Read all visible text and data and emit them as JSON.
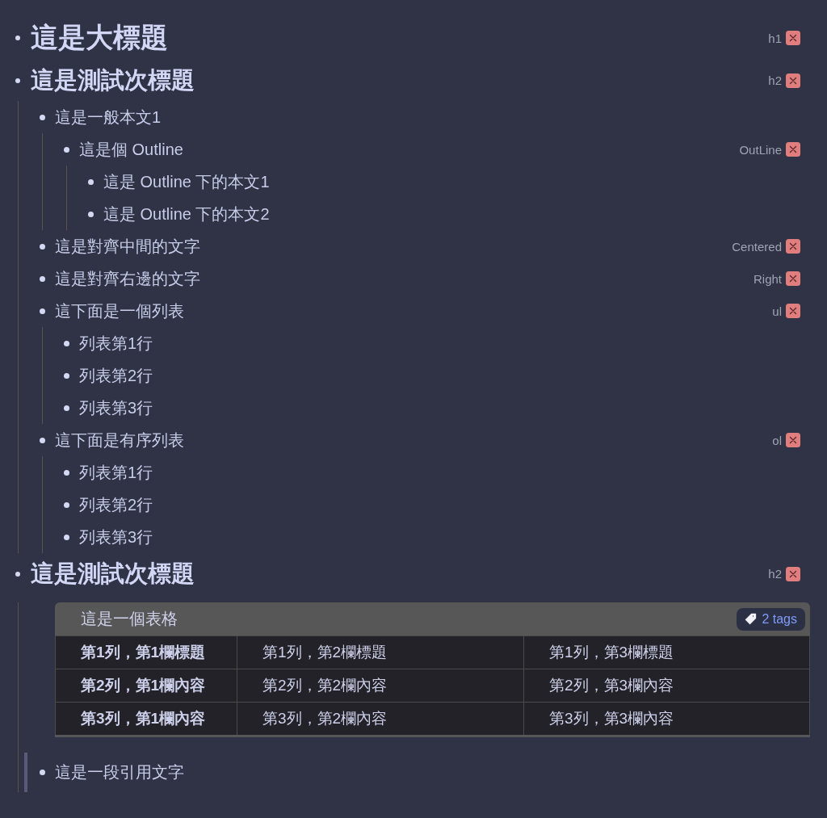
{
  "outline": [
    {
      "kind": "h1",
      "text": "這是大標題",
      "tag": "h1"
    },
    {
      "kind": "h2",
      "text": "這是測試次標題",
      "tag": "h2",
      "children": [
        {
          "kind": "text",
          "text": "這是一般本文1",
          "children": [
            {
              "kind": "text",
              "text": "這是個 Outline",
              "tag": "OutLine",
              "children": [
                {
                  "kind": "text",
                  "text": "這是 Outline 下的本文1"
                },
                {
                  "kind": "text",
                  "text": "這是 Outline 下的本文2"
                }
              ]
            }
          ]
        },
        {
          "kind": "text",
          "text": "這是對齊中間的文字",
          "tag": "Centered"
        },
        {
          "kind": "text",
          "text": "這是對齊右邊的文字",
          "tag": "Right"
        },
        {
          "kind": "text",
          "text": "這下面是一個列表",
          "tag": "ul",
          "children": [
            {
              "kind": "text",
              "text": "列表第1行"
            },
            {
              "kind": "text",
              "text": "列表第2行"
            },
            {
              "kind": "text",
              "text": "列表第3行"
            }
          ]
        },
        {
          "kind": "text",
          "text": "這下面是有序列表",
          "tag": "ol",
          "children": [
            {
              "kind": "text",
              "text": "列表第1行"
            },
            {
              "kind": "text",
              "text": "列表第2行"
            },
            {
              "kind": "text",
              "text": "列表第3行"
            }
          ]
        }
      ]
    },
    {
      "kind": "h2",
      "text": "這是測試次標題",
      "tag": "h2",
      "children": [
        {
          "kind": "table",
          "title": "這是一個表格",
          "tags_button": "2 tags",
          "rows": [
            [
              "第1列，第1欄標題",
              "第1列，第2欄標題",
              "第1列，第3欄標題"
            ],
            [
              "第2列，第1欄內容",
              "第2列，第2欄內容",
              "第2列，第3欄內容"
            ],
            [
              "第3列，第1欄內容",
              "第3列，第2欄內容",
              "第3列，第3欄內容"
            ]
          ]
        },
        {
          "kind": "quote",
          "text": "這是一段引用文字"
        }
      ]
    }
  ]
}
